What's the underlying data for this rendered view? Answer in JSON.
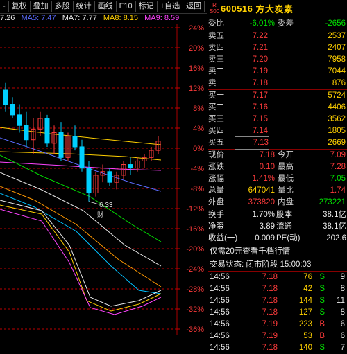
{
  "toolbar": {
    "items": [
      "复权",
      "叠加",
      "多股",
      "统计",
      "画线",
      "F10",
      "标记",
      "+自选",
      "返回"
    ],
    "first_fragment": "-"
  },
  "ma": [
    {
      "text": "7.26",
      "color": "#e8e8e8"
    },
    {
      "text": "MA5: 7.47",
      "color": "#5b6cff"
    },
    {
      "text": "MA7: 7.77",
      "color": "#e8e8e8"
    },
    {
      "text": "MA8: 8.15",
      "color": "#ffd000"
    },
    {
      "text": "MA9: 8.59",
      "color": "#ff44ff"
    }
  ],
  "chart_data": {
    "type": "candlestick",
    "y_ticks": [
      "24%",
      "20%",
      "16%",
      "12%",
      "8%",
      "4%",
      "0%",
      "-4%",
      "-8%",
      "-12%",
      "-16%",
      "-20%",
      "-24%",
      "-28%",
      "-32%",
      "-36%"
    ],
    "annotation": "6.33",
    "marker": "财",
    "candles": [
      {
        "o": 7.9,
        "h": 8.0,
        "l": 7.6,
        "c": 7.7
      },
      {
        "o": 7.7,
        "h": 7.8,
        "l": 7.5,
        "c": 7.55
      },
      {
        "o": 7.55,
        "h": 7.7,
        "l": 7.3,
        "c": 7.4
      },
      {
        "o": 7.4,
        "h": 7.6,
        "l": 7.1,
        "c": 7.2
      },
      {
        "o": 7.2,
        "h": 7.5,
        "l": 7.0,
        "c": 7.35
      },
      {
        "o": 7.35,
        "h": 7.6,
        "l": 7.25,
        "c": 7.5
      },
      {
        "o": 7.5,
        "h": 7.55,
        "l": 7.1,
        "c": 7.15
      },
      {
        "o": 7.15,
        "h": 7.4,
        "l": 7.0,
        "c": 7.3
      },
      {
        "o": 7.3,
        "h": 7.45,
        "l": 6.9,
        "c": 6.95
      },
      {
        "o": 6.95,
        "h": 7.3,
        "l": 6.9,
        "c": 7.25
      },
      {
        "o": 7.25,
        "h": 7.4,
        "l": 7.05,
        "c": 7.1
      },
      {
        "o": 7.1,
        "h": 7.2,
        "l": 6.75,
        "c": 6.8
      },
      {
        "o": 6.8,
        "h": 6.9,
        "l": 6.33,
        "c": 6.45
      },
      {
        "o": 6.45,
        "h": 6.75,
        "l": 6.4,
        "c": 6.7
      },
      {
        "o": 6.7,
        "h": 6.85,
        "l": 6.6,
        "c": 6.75
      },
      {
        "o": 6.75,
        "h": 6.8,
        "l": 6.55,
        "c": 6.6
      },
      {
        "o": 6.6,
        "h": 6.75,
        "l": 6.5,
        "c": 6.7
      },
      {
        "o": 6.7,
        "h": 6.9,
        "l": 6.65,
        "c": 6.85
      },
      {
        "o": 6.85,
        "h": 6.95,
        "l": 6.7,
        "c": 6.8
      },
      {
        "o": 6.8,
        "h": 6.95,
        "l": 6.75,
        "c": 6.9
      },
      {
        "o": 6.9,
        "h": 7.0,
        "l": 6.8,
        "c": 6.95
      },
      {
        "o": 6.95,
        "h": 7.1,
        "l": 6.9,
        "c": 7.05
      },
      {
        "o": 7.05,
        "h": 7.25,
        "l": 7.0,
        "c": 7.18
      }
    ]
  },
  "stock": {
    "r_label": "R",
    "s_label": "S00",
    "code": "600516",
    "name": "方大炭素"
  },
  "weibi": {
    "label": "委比",
    "value": "-6.01%",
    "label2": "委差",
    "value2": "-2656"
  },
  "asks": [
    {
      "label": "卖五",
      "price": "7.22",
      "vol": "2537"
    },
    {
      "label": "卖四",
      "price": "7.21",
      "vol": "2407"
    },
    {
      "label": "卖三",
      "price": "7.20",
      "vol": "7958"
    },
    {
      "label": "卖二",
      "price": "7.19",
      "vol": "7044"
    },
    {
      "label": "卖一",
      "price": "7.18",
      "vol": "876"
    }
  ],
  "bids": [
    {
      "label": "买一",
      "price": "7.17",
      "vol": "5724"
    },
    {
      "label": "买二",
      "price": "7.16",
      "vol": "4406"
    },
    {
      "label": "买三",
      "price": "7.15",
      "vol": "3562"
    },
    {
      "label": "买四",
      "price": "7.14",
      "vol": "1805"
    },
    {
      "label": "买五",
      "price": "7.13",
      "vol": "2669"
    }
  ],
  "quote": [
    {
      "l1": "现价",
      "v1": "7.18",
      "c1": "#ff3b3b",
      "l2": "今开",
      "v2": "7.09",
      "c2": "#ff3b3b"
    },
    {
      "l1": "涨跌",
      "v1": "0.10",
      "c1": "#ff3b3b",
      "l2": "最高",
      "v2": "7.28",
      "c2": "#ff3b3b"
    },
    {
      "l1": "涨幅",
      "v1": "1.41%",
      "c1": "#ff3b3b",
      "l2": "最低",
      "v2": "7.05",
      "c2": "#00e000"
    },
    {
      "l1": "总量",
      "v1": "647041",
      "c1": "#ffd000",
      "l2": "量比",
      "v2": "1.74",
      "c2": "#ff3b3b"
    },
    {
      "l1": "外盘",
      "v1": "373820",
      "c1": "#ff3b3b",
      "l2": "内盘",
      "v2": "273221",
      "c2": "#00e000"
    }
  ],
  "stats": [
    {
      "l1": "换手",
      "v1": "1.70%",
      "l2": "股本",
      "v2": "38.1亿"
    },
    {
      "l1": "净资",
      "v1": "3.89",
      "l2": "流通",
      "v2": "38.1亿"
    },
    {
      "l1": "收益(一)",
      "v1": "0.009",
      "l2": "PE(动)",
      "v2": "202.6"
    }
  ],
  "promo": "仅需20元查看千档行情",
  "status": "交易状态: 闭市阶段 15:00:03",
  "trades": [
    {
      "time": "14:56",
      "price": "7.18",
      "vol": "76",
      "side": "S",
      "n": "9"
    },
    {
      "time": "14:56",
      "price": "7.18",
      "vol": "42",
      "side": "S",
      "n": "8"
    },
    {
      "time": "14:56",
      "price": "7.18",
      "vol": "144",
      "side": "S",
      "n": "11"
    },
    {
      "time": "14:56",
      "price": "7.18",
      "vol": "127",
      "side": "S",
      "n": "8"
    },
    {
      "time": "14:56",
      "price": "7.19",
      "vol": "223",
      "side": "B",
      "n": "6"
    },
    {
      "time": "14:56",
      "price": "7.19",
      "vol": "53",
      "side": "B",
      "n": "6"
    },
    {
      "time": "14:56",
      "price": "7.18",
      "vol": "140",
      "side": "S",
      "n": "7"
    }
  ]
}
